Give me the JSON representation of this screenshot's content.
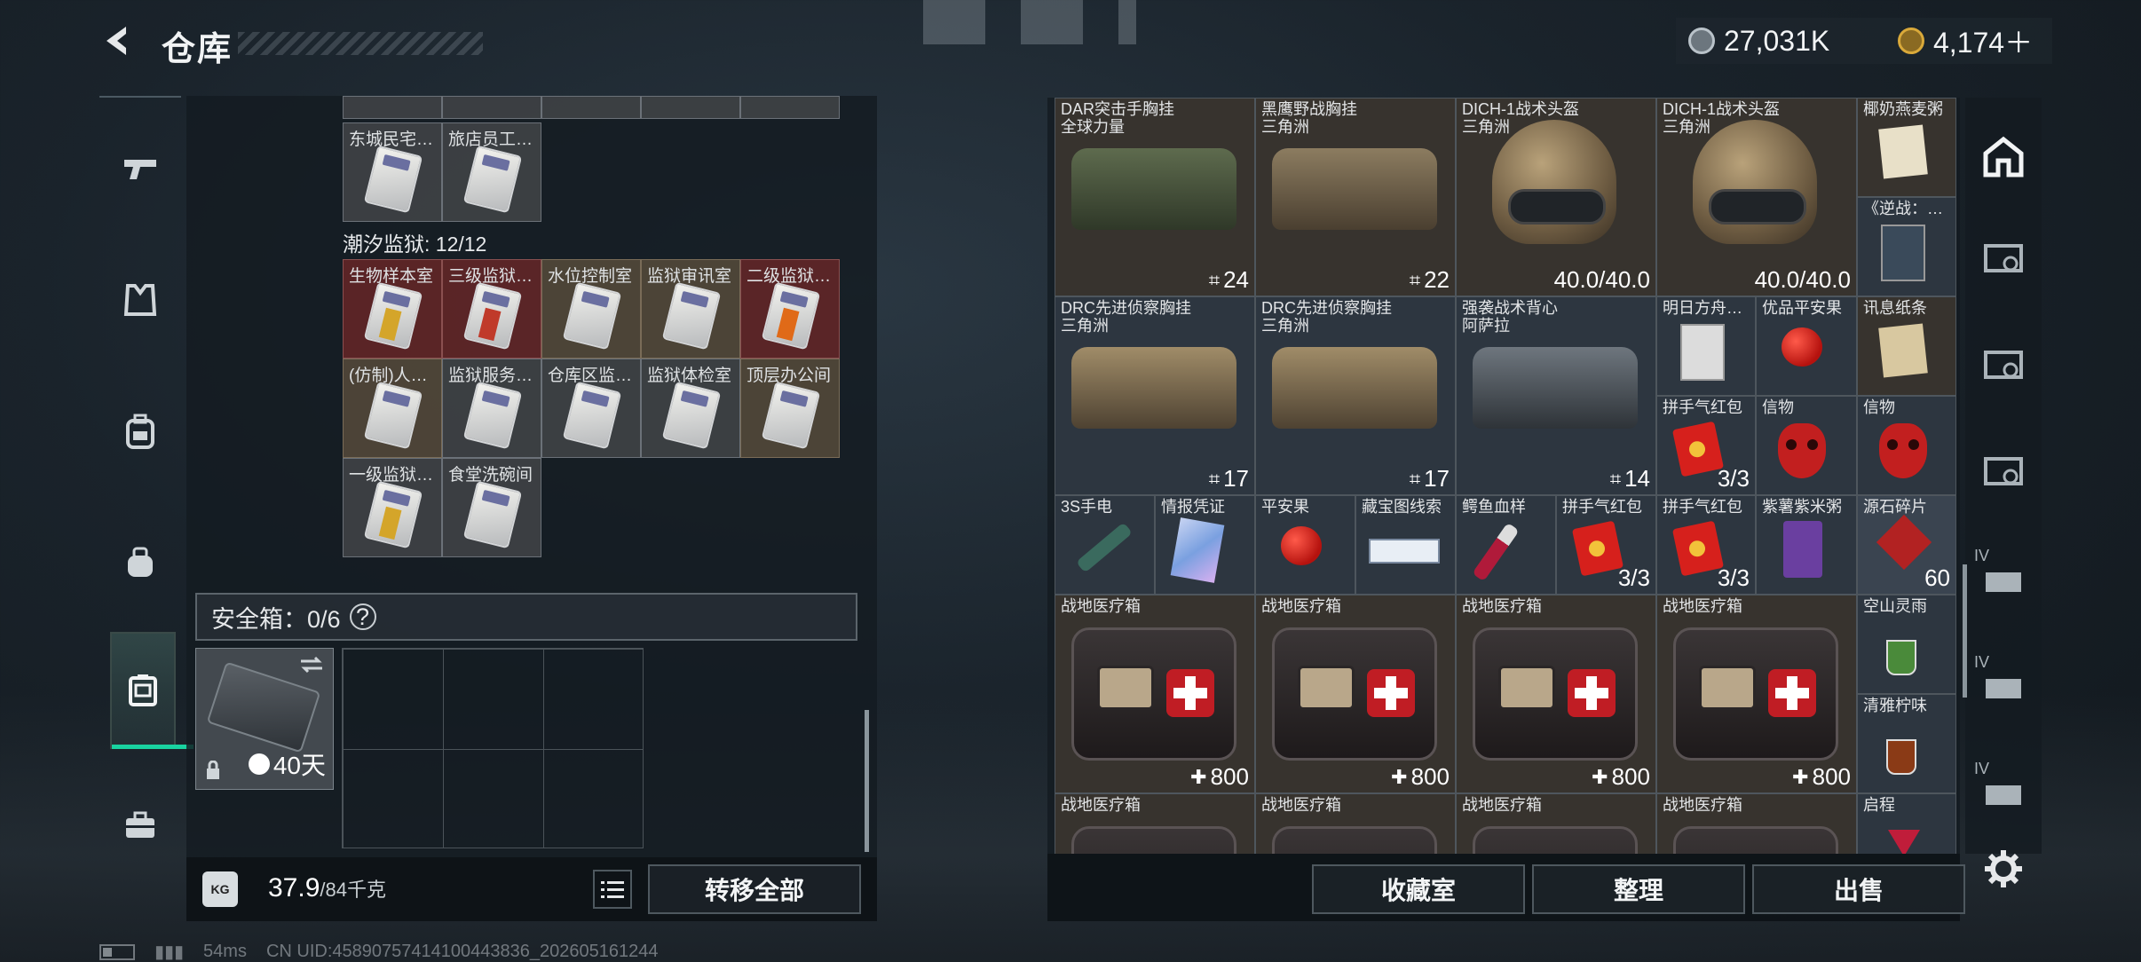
{
  "header": {
    "title": "仓库",
    "currency": [
      {
        "icon": "silver-coin-icon",
        "value": "27,031K"
      },
      {
        "icon": "gold-triangle-coin-icon",
        "value": "4,174＋"
      }
    ]
  },
  "left_rail": [
    {
      "icon": "pistol-icon"
    },
    {
      "icon": "chest-rig-icon"
    },
    {
      "icon": "backpack-icon"
    },
    {
      "icon": "small-bag-icon"
    },
    {
      "icon": "safebox-icon",
      "active": true
    },
    {
      "icon": "briefcase-icon"
    }
  ],
  "keycards_top": [
    "东城民宅…",
    "旅店员工…"
  ],
  "prison": {
    "section_label": "潮汐监狱: 12/12",
    "cards": [
      "生物样本室",
      "三级监狱…",
      "水位控制室",
      "监狱审讯室",
      "二级监狱…",
      "(仿制)人…",
      "监狱服务…",
      "仓库区监…",
      "监狱体检室",
      "顶层办公间",
      "一级监狱…",
      "食堂洗碗间"
    ]
  },
  "safebox": {
    "label": "安全箱：0/6",
    "help": "?",
    "item_days": "40天"
  },
  "weight": {
    "current": "37.9",
    "max": "/84千克",
    "icon_text": "KG"
  },
  "buttons": {
    "transfer_all": "转移全部",
    "collection": "收藏室",
    "organize": "整理",
    "sell": "出售"
  },
  "stash_items": [
    {
      "name": "DAR突击手胸挂",
      "origin": "全球力量",
      "count": "24"
    },
    {
      "name": "黑鹰野战胸挂",
      "origin": "三角洲",
      "count": "22"
    },
    {
      "name": "DICH-1战术头盔",
      "origin": "三角洲",
      "count": "40.0/40.0"
    },
    {
      "name": "DICH-1战术头盔",
      "origin": "三角洲",
      "count": "40.0/40.0"
    },
    {
      "name": "DRC先进侦察胸挂",
      "origin": "三角洲",
      "count": "17"
    },
    {
      "name": "DRC先进侦察胸挂",
      "origin": "三角洲",
      "count": "17"
    },
    {
      "name": "强袭战术背心",
      "origin": "阿萨拉",
      "count": "14"
    },
    {
      "name": "战地医疗箱",
      "count": "800"
    },
    {
      "name": "战地医疗箱",
      "count": "800"
    },
    {
      "name": "战地医疗箱",
      "count": "800"
    },
    {
      "name": "战地医疗箱",
      "count": "800"
    },
    {
      "name": "战地医疗箱"
    },
    {
      "name": "战地医疗箱"
    },
    {
      "name": "战地医疗箱"
    },
    {
      "name": "战地医疗箱"
    }
  ],
  "small_items": [
    {
      "name": "椰奶燕麦粥"
    },
    {
      "name": "《逆战：…"
    },
    {
      "name": "明日方舟…"
    },
    {
      "name": "优品平安果"
    },
    {
      "name": "讯息纸条"
    },
    {
      "name": "拼手气红包",
      "count": "3/3"
    },
    {
      "name": "信物"
    },
    {
      "name": "信物"
    },
    {
      "name": "3S手电"
    },
    {
      "name": "情报凭证"
    },
    {
      "name": "平安果"
    },
    {
      "name": "藏宝图线索"
    },
    {
      "name": "鳄鱼血样"
    },
    {
      "name": "拼手气红包",
      "count": "3/3"
    },
    {
      "name": "拼手气红包",
      "count": "3/3"
    },
    {
      "name": "紫薯紫米粥"
    },
    {
      "name": "源石碎片",
      "count": "60"
    },
    {
      "name": "空山灵雨"
    },
    {
      "name": "清雅柠味"
    },
    {
      "name": "启程"
    }
  ],
  "right_rail_labels": [
    "IV",
    "IV",
    "IV"
  ],
  "status": {
    "ping": "54ms",
    "uid": "CN UID:45890757414100443836_202605161244"
  },
  "colors": {
    "accent": "#19d3a0",
    "red_slot": "#782828",
    "medkit_cross": "#c01d24"
  }
}
